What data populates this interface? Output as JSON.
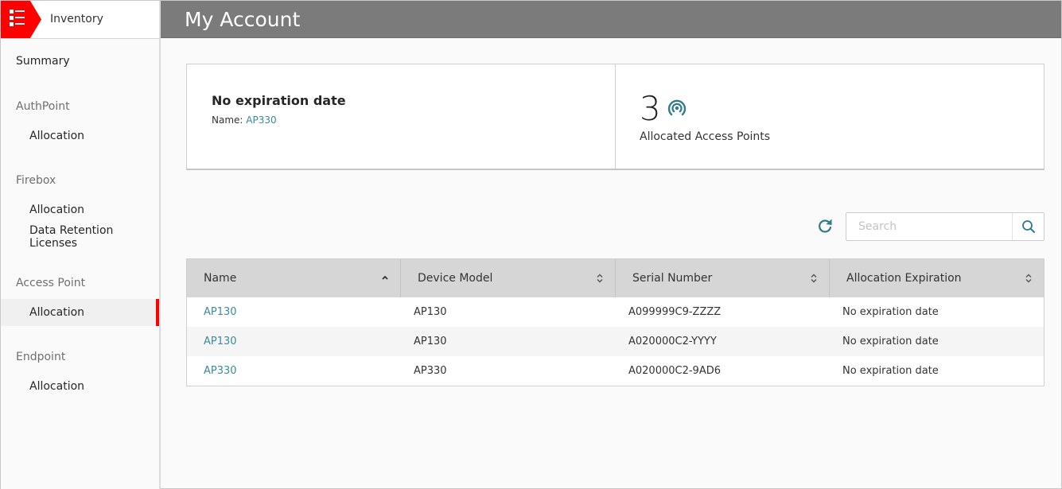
{
  "app": {
    "section_title": "Inventory",
    "menu_icon": "list-menu-icon",
    "brand_color": "#ff0000"
  },
  "sidebar": {
    "summary": "Summary",
    "groups": [
      {
        "label": "AuthPoint",
        "items": [
          "Allocation"
        ]
      },
      {
        "label": "Firebox",
        "items": [
          "Allocation",
          "Data Retention Licenses"
        ]
      },
      {
        "label": "Access Point",
        "items": [
          "Allocation"
        ],
        "active_item": "Allocation"
      },
      {
        "label": "Endpoint",
        "items": [
          "Allocation"
        ]
      }
    ]
  },
  "header": {
    "title": "My Account"
  },
  "summary_cards": {
    "expiration": {
      "heading": "No expiration date",
      "name_label": "Name:",
      "name_value": "AP330"
    },
    "allocated": {
      "count": "3",
      "icon": "access-point-icon",
      "label": "Allocated Access Points"
    }
  },
  "toolbar": {
    "refresh_icon": "refresh-icon",
    "search_placeholder": "Search",
    "search_value": "",
    "search_icon": "search-icon"
  },
  "table": {
    "columns": [
      {
        "label": "Name",
        "sort": "ascending"
      },
      {
        "label": "Device Model",
        "sort": "none"
      },
      {
        "label": "Serial Number",
        "sort": "none"
      },
      {
        "label": "Allocation Expiration",
        "sort": "none"
      }
    ],
    "rows": [
      {
        "name": "AP130",
        "model": "AP130",
        "serial": "A099999C9-ZZZZ",
        "expiration": "No expiration date"
      },
      {
        "name": "AP130",
        "model": "AP130",
        "serial": "A020000C2-YYYY",
        "expiration": "No expiration date"
      },
      {
        "name": "AP330",
        "model": "AP330",
        "serial": "A020000C2-9AD6",
        "expiration": "No expiration date"
      }
    ]
  },
  "colors": {
    "accent_link": "#3b8a9a",
    "header_bg": "#7b7b7b",
    "active_indicator": "#ff0000"
  }
}
